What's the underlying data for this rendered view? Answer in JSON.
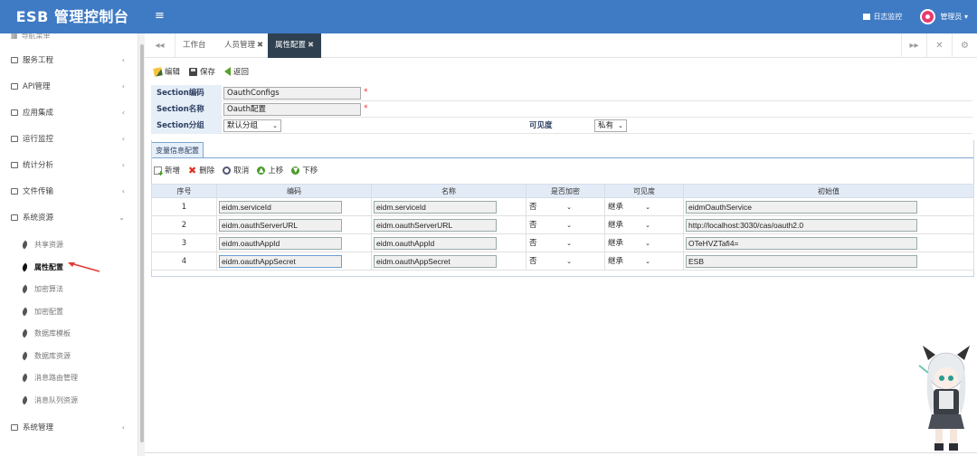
{
  "app": {
    "title": "ESB 管理控制台",
    "menu_toggle": "≡"
  },
  "header": {
    "log_monitor": "日志监控",
    "user": "管理员 ▾"
  },
  "sidebar": {
    "head": "导航菜单",
    "items": [
      {
        "label": "服务工程",
        "chevron": "‹"
      },
      {
        "label": "API管理",
        "chevron": "‹"
      },
      {
        "label": "应用集成",
        "chevron": "‹"
      },
      {
        "label": "运行监控",
        "chevron": "‹"
      },
      {
        "label": "统计分析",
        "chevron": "‹"
      },
      {
        "label": "文件传输",
        "chevron": "‹"
      },
      {
        "label": "系统资源",
        "chevron": "⌄"
      },
      {
        "label": "系统管理",
        "chevron": "‹"
      }
    ],
    "subitems": [
      {
        "label": "共享资源"
      },
      {
        "label": "属性配置"
      },
      {
        "label": "加密算法"
      },
      {
        "label": "加密配置"
      },
      {
        "label": "数据库模板"
      },
      {
        "label": "数据库资源"
      },
      {
        "label": "消息路由管理"
      },
      {
        "label": "消息队列资源"
      }
    ]
  },
  "tabs": {
    "nav_prev": "◂◂",
    "items": [
      {
        "label": "工作台",
        "close": ""
      },
      {
        "label": "人员管理",
        "close": "✖"
      },
      {
        "label": "属性配置",
        "close": "✖"
      }
    ],
    "nav_next": "▸▸",
    "fullscreen": "✕",
    "settings": "⚙"
  },
  "toolbar": {
    "edit": "编辑",
    "save": "保存",
    "back": "返回"
  },
  "form": {
    "code_label": "Section编码",
    "code_value": "OauthConfigs",
    "name_label": "Section名称",
    "name_value": "Oauth配置",
    "group_label": "Section分组",
    "group_value": "默认分组",
    "visibility_label": "可见度",
    "visibility_value": "私有",
    "required_mark": "*"
  },
  "panel": {
    "tab": "变量信息配置"
  },
  "grid_toolbar": {
    "add": "新增",
    "delete": "删除",
    "cancel": "取消",
    "up": "上移",
    "down": "下移"
  },
  "grid": {
    "headers": [
      "序号",
      "编码",
      "名称",
      "是否加密",
      "可见度",
      "初始值"
    ],
    "rows": [
      {
        "num": "1",
        "code": "eidm.serviceId",
        "name": "eidm.serviceId",
        "encrypt": "否",
        "visibility": "继承",
        "value": "eidmOauthService"
      },
      {
        "num": "2",
        "code": "eidm.oauthServerURL",
        "name": "eidm.oauthServerURL",
        "encrypt": "否",
        "visibility": "继承",
        "value": "http://localhost:3030/cas/oauth2.0"
      },
      {
        "num": "3",
        "code": "eidm.oauthAppId",
        "name": "eidm.oauthAppId",
        "encrypt": "否",
        "visibility": "继承",
        "value": "OTeHVZTafi4="
      },
      {
        "num": "4",
        "code": "eidm.oauthAppSecret",
        "name": "eidm.oauthAppSecret",
        "encrypt": "否",
        "visibility": "继承",
        "value": "ESB"
      }
    ]
  },
  "colors": {
    "header_bg": "#3f7ac4",
    "active_tab_bg": "#2f4050",
    "form_label_bg": "#e6eef8",
    "required": "#ee3333",
    "annotation_arrow": "#e53935"
  }
}
